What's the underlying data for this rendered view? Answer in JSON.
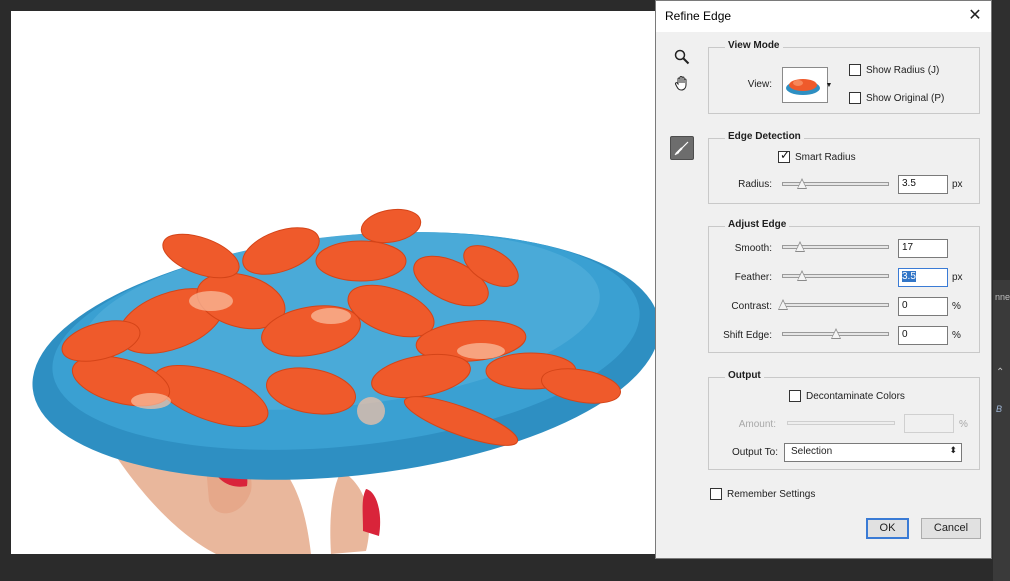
{
  "dialog": {
    "title": "Refine Edge",
    "close_icon": "close-icon",
    "view_mode": {
      "title": "View Mode",
      "view_label": "View:",
      "show_radius": "Show Radius (J)",
      "show_original": "Show Original (P)"
    },
    "edge_detection": {
      "title": "Edge Detection",
      "smart_radius": "Smart Radius",
      "radius_label": "Radius:",
      "radius_value": "3.5",
      "radius_unit": "px"
    },
    "adjust_edge": {
      "title": "Adjust Edge",
      "smooth_label": "Smooth:",
      "smooth_value": "17",
      "feather_label": "Feather:",
      "feather_value": "3.5",
      "feather_unit": "px",
      "contrast_label": "Contrast:",
      "contrast_value": "0",
      "contrast_unit": "%",
      "shift_label": "Shift Edge:",
      "shift_value": "0",
      "shift_unit": "%"
    },
    "output": {
      "title": "Output",
      "decontaminate": "Decontaminate Colors",
      "amount_label": "Amount:",
      "amount_unit": "%",
      "output_to_label": "Output To:",
      "output_to_value": "Selection"
    },
    "remember": "Remember Settings",
    "ok": "OK",
    "cancel": "Cancel"
  },
  "right_panel": {
    "label1": "nne",
    "label2": "B"
  },
  "colors": {
    "accent": "#3a7bd5",
    "plate": "#2e8fc2",
    "shrimp": "#ef5a2b"
  }
}
